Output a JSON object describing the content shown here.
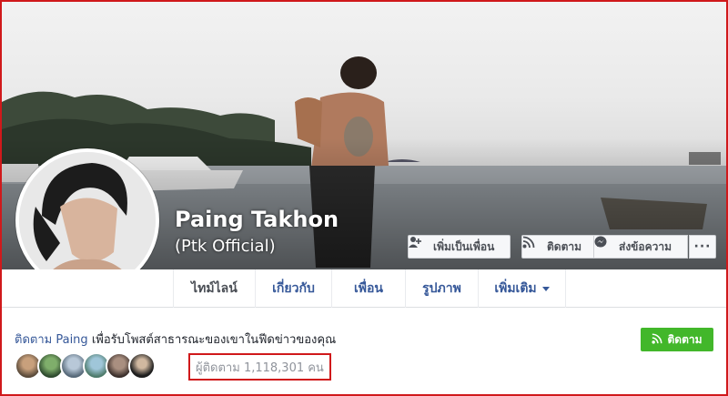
{
  "profile": {
    "name": "Paing Takhon",
    "alias": "(Ptk Official)"
  },
  "cover_actions": {
    "add_friend": "เพิ่มเป็นเพื่อน",
    "follow": "ติดตาม",
    "message": "ส่งข้อความ",
    "more": "···"
  },
  "tabs": [
    {
      "label": "ไทม์ไลน์",
      "active": true
    },
    {
      "label": "เกี่ยวกับ",
      "active": false
    },
    {
      "label": "เพื่อน",
      "active": false
    },
    {
      "label": "รูปภาพ",
      "active": false
    },
    {
      "label": "เพิ่มเติม",
      "active": false
    }
  ],
  "follow_prompt": {
    "prefix": "ติดตาม",
    "name": "Paing",
    "suffix": "เพื่อรับโพสต์สาธารณะของเขาในฟีดข่าวของคุณ"
  },
  "follow_button": "ติดตาม",
  "followers": {
    "count_text": "ผู้ติดตาม 1,118,301 คน"
  },
  "icons": {
    "add_friend": "add-friend-icon",
    "follow": "rss-icon",
    "message": "messenger-icon"
  },
  "colors": {
    "link": "#365899",
    "follow_green": "#42b72a",
    "highlight_border": "#d0191b"
  }
}
